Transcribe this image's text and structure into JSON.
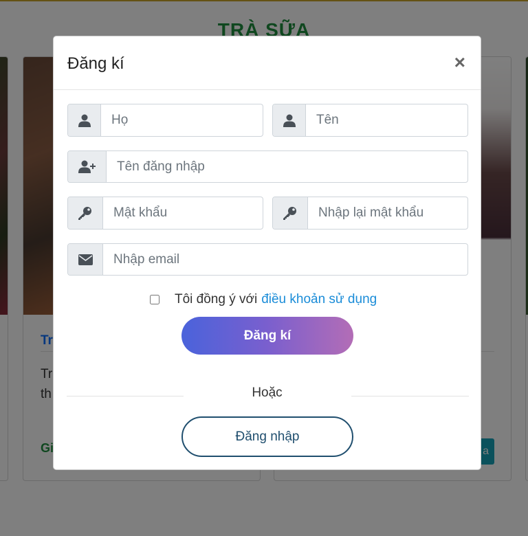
{
  "background": {
    "section_title": "TRÀ SỮA",
    "card_title": "Tr",
    "card_text_line1": "Tra",
    "card_text_line2": "th",
    "card_price": "Gi",
    "card_button_fragment": "a"
  },
  "modal": {
    "title": "Đăng kí",
    "close_symbol": "×",
    "fields": {
      "last_name_placeholder": "Họ",
      "first_name_placeholder": "Tên",
      "username_placeholder": "Tên đăng nhập",
      "password_placeholder": "Mật khẩu",
      "confirm_password_placeholder": "Nhập lại mật khẩu",
      "email_placeholder": "Nhập email"
    },
    "icons": {
      "last_name": "user-icon",
      "first_name": "user-icon",
      "username": "user-plus-icon",
      "password": "key-icon",
      "confirm_password": "key-icon",
      "email": "envelope-icon"
    },
    "agree_text": "Tôi đồng ý với",
    "agree_link": "điều khoản sử dụng",
    "register_button": "Đăng kí",
    "or_text": "Hoặc",
    "login_button": "Đăng nhập"
  },
  "colors": {
    "accent_green": "#1e8e3e",
    "link_blue": "#1a8cd8",
    "gradient_start": "#4a63db",
    "gradient_end": "#b36db6",
    "login_border": "#1f4e6e"
  }
}
